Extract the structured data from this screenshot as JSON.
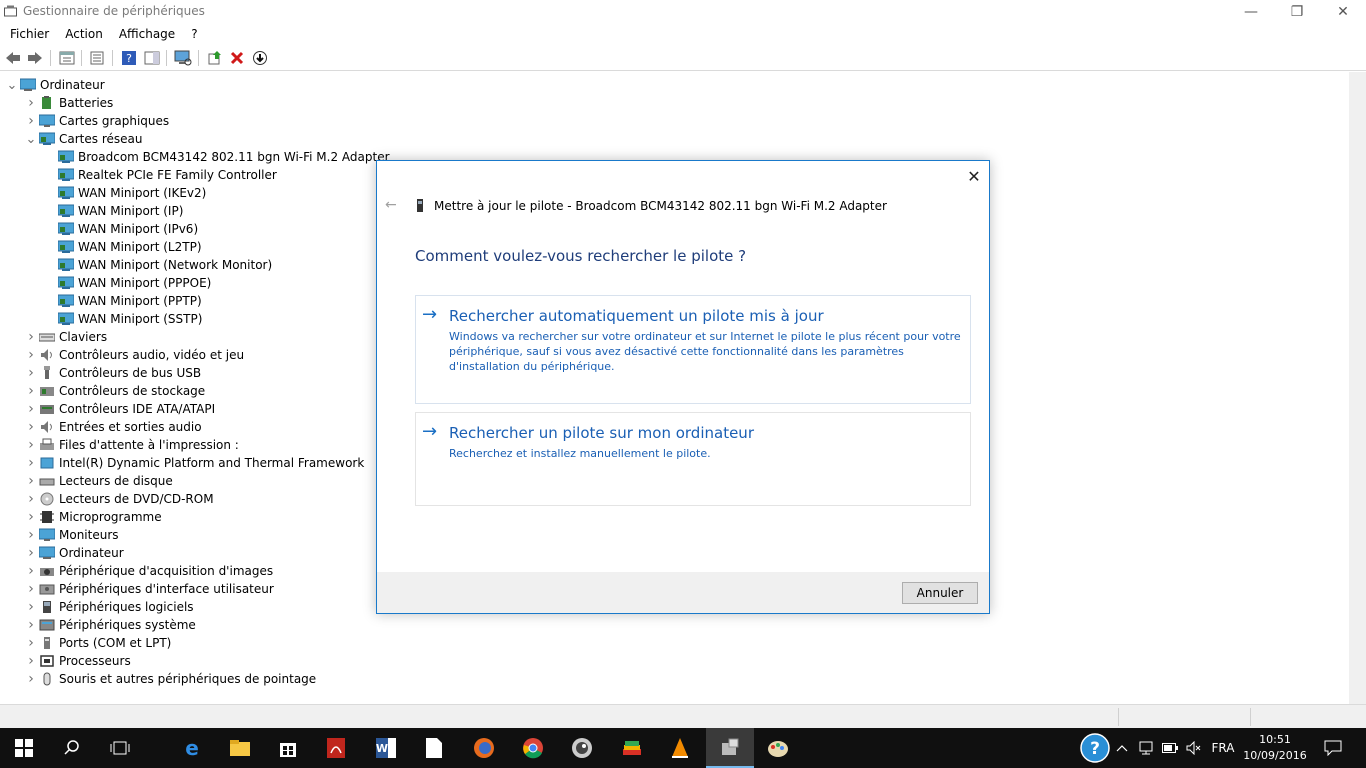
{
  "window": {
    "title": "Gestionnaire de périphériques",
    "minimize_label": "—",
    "maximize_label": "❐",
    "close_label": "✕"
  },
  "menu": [
    "Fichier",
    "Action",
    "Affichage",
    "?"
  ],
  "tree": {
    "root": "Ordinateur",
    "items": [
      {
        "label": "Batteries",
        "icon": "battery-icon"
      },
      {
        "label": "Cartes graphiques",
        "icon": "display-adapter-icon"
      },
      {
        "label": "Cartes réseau",
        "icon": "network-adapter-icon",
        "expanded": true,
        "children": [
          "Broadcom BCM43142 802.11 bgn Wi-Fi M.2 Adapter",
          "Realtek PCIe FE Family Controller",
          "WAN Miniport (IKEv2)",
          "WAN Miniport (IP)",
          "WAN Miniport (IPv6)",
          "WAN Miniport (L2TP)",
          "WAN Miniport (Network Monitor)",
          "WAN Miniport (PPPOE)",
          "WAN Miniport (PPTP)",
          "WAN Miniport (SSTP)"
        ]
      },
      {
        "label": "Claviers",
        "icon": "keyboard-icon"
      },
      {
        "label": "Contrôleurs audio, vidéo et jeu",
        "icon": "speaker-icon"
      },
      {
        "label": "Contrôleurs de bus USB",
        "icon": "usb-icon"
      },
      {
        "label": "Contrôleurs de stockage",
        "icon": "storage-controller-icon"
      },
      {
        "label": "Contrôleurs IDE ATA/ATAPI",
        "icon": "ide-controller-icon"
      },
      {
        "label": "Entrées et sorties audio",
        "icon": "speaker-icon"
      },
      {
        "label": "Files d'attente à l'impression :",
        "icon": "printer-icon"
      },
      {
        "label": "Intel(R) Dynamic Platform and Thermal Framework",
        "icon": "chip-icon"
      },
      {
        "label": "Lecteurs de disque",
        "icon": "disk-drive-icon"
      },
      {
        "label": "Lecteurs de DVD/CD-ROM",
        "icon": "dvd-icon"
      },
      {
        "label": "Microprogramme",
        "icon": "firmware-icon"
      },
      {
        "label": "Moniteurs",
        "icon": "monitor-icon"
      },
      {
        "label": "Ordinateur",
        "icon": "computer-icon"
      },
      {
        "label": "Périphérique d'acquisition d'images",
        "icon": "camera-icon"
      },
      {
        "label": "Périphériques d'interface utilisateur",
        "icon": "hid-icon"
      },
      {
        "label": "Périphériques logiciels",
        "icon": "software-device-icon"
      },
      {
        "label": "Périphériques système",
        "icon": "system-device-icon"
      },
      {
        "label": "Ports (COM et LPT)",
        "icon": "port-icon"
      },
      {
        "label": "Processeurs",
        "icon": "processor-icon"
      },
      {
        "label": "Souris et autres périphériques de pointage",
        "icon": "mouse-icon"
      }
    ]
  },
  "dialog": {
    "title": "Mettre à jour le pilote - Broadcom BCM43142 802.11 bgn Wi-Fi M.2 Adapter",
    "question": "Comment voulez-vous rechercher le pilote ?",
    "option1": {
      "title": "Rechercher automatiquement un pilote mis à jour",
      "description": "Windows va rechercher sur votre ordinateur et sur Internet le pilote le plus récent pour votre périphérique, sauf si vous avez désactivé cette fonctionnalité dans les paramètres d'installation du périphérique."
    },
    "option2": {
      "title": "Rechercher un pilote sur mon ordinateur",
      "description": "Recherchez et installez manuellement le pilote."
    },
    "cancel_label": "Annuler",
    "close_label": "✕",
    "back_label": "←"
  },
  "taskbar": {
    "language": "FRA",
    "time": "10:51",
    "date": "10/09/2016",
    "help_label": "?"
  },
  "colors": {
    "dialog_border": "#1979ca",
    "link_blue": "#1a5fb4",
    "taskbar": "#101010"
  }
}
